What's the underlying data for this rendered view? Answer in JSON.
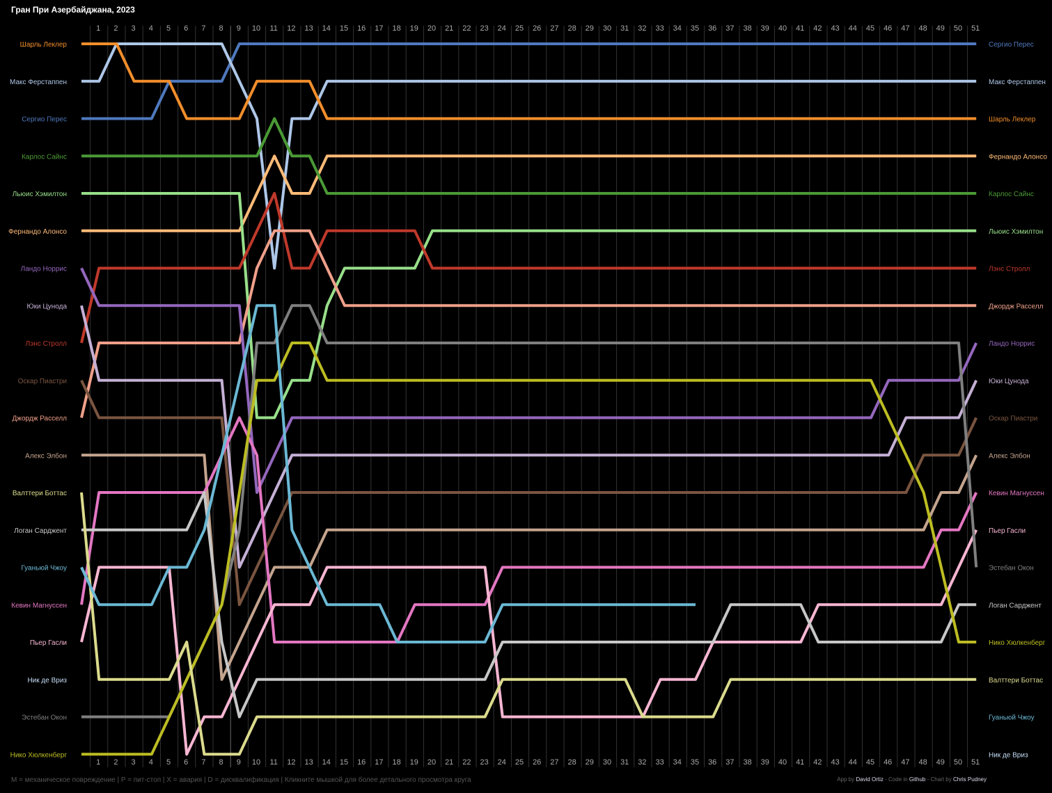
{
  "title": "Гран При Азербайджана, 2023",
  "footer": {
    "legend": "M = механическое повреждение | P = пит-стоп | X = авария | D = дисквалификация | Кликните мышкой для более детального просмотра круга",
    "credits": {
      "app_prefix": "App by ",
      "app_author": "David Ortiz",
      "code_prefix": " - Code in ",
      "code_host": "Github",
      "chart_prefix": " - Chart by ",
      "chart_author": "Chris Pudney"
    }
  },
  "chart_data": {
    "type": "line",
    "title": "Гран При Азербайджана, 2023",
    "x_labels": [
      "1",
      "2",
      "3",
      "4",
      "5",
      "6",
      "7",
      "8",
      "9",
      "10",
      "11",
      "12",
      "13",
      "14",
      "15",
      "16",
      "17",
      "18",
      "19",
      "20",
      "21",
      "22",
      "23",
      "24",
      "25",
      "26",
      "27",
      "28",
      "29",
      "30",
      "31",
      "32",
      "33",
      "34",
      "35",
      "36",
      "37",
      "38",
      "39",
      "40",
      "41",
      "42",
      "43",
      "44",
      "45",
      "46",
      "47",
      "48",
      "49",
      "50",
      "51"
    ],
    "xlim": [
      0,
      51
    ],
    "y_axis": "position",
    "ylim": [
      1,
      20
    ],
    "y_inverted": true,
    "grid": true,
    "series": [
      {
        "name": "Сергио Перес",
        "color": "#4f79bd",
        "start": 3,
        "laps": [
          3,
          3,
          3,
          3,
          2,
          2,
          2,
          2,
          1,
          1,
          1,
          1,
          1,
          1,
          1,
          1,
          1,
          1,
          1,
          1,
          1,
          1,
          1,
          1,
          1,
          1,
          1,
          1,
          1,
          1,
          1,
          1,
          1,
          1,
          1,
          1,
          1,
          1,
          1,
          1,
          1,
          1,
          1,
          1,
          1,
          1,
          1,
          1,
          1,
          1,
          1
        ]
      },
      {
        "name": "Макс Ферстаппен",
        "color": "#aec7e8",
        "start": 2,
        "laps": [
          2,
          1,
          1,
          1,
          1,
          1,
          1,
          1,
          2,
          3,
          7,
          3,
          3,
          2,
          2,
          2,
          2,
          2,
          2,
          2,
          2,
          2,
          2,
          2,
          2,
          2,
          2,
          2,
          2,
          2,
          2,
          2,
          2,
          2,
          2,
          2,
          2,
          2,
          2,
          2,
          2,
          2,
          2,
          2,
          2,
          2,
          2,
          2,
          2,
          2,
          2
        ]
      },
      {
        "name": "Шарль Леклер",
        "color": "#f28e2b",
        "start": 1,
        "laps": [
          1,
          1,
          2,
          2,
          2,
          3,
          3,
          3,
          3,
          2,
          2,
          2,
          2,
          3,
          3,
          3,
          3,
          3,
          3,
          3,
          3,
          3,
          3,
          3,
          3,
          3,
          3,
          3,
          3,
          3,
          3,
          3,
          3,
          3,
          3,
          3,
          3,
          3,
          3,
          3,
          3,
          3,
          3,
          3,
          3,
          3,
          3,
          3,
          3,
          3,
          3
        ]
      },
      {
        "name": "Фернандо Алонсо",
        "color": "#ffbb78",
        "start": 6,
        "laps": [
          6,
          6,
          6,
          6,
          6,
          6,
          6,
          6,
          6,
          5,
          4,
          5,
          5,
          4,
          4,
          4,
          4,
          4,
          4,
          4,
          4,
          4,
          4,
          4,
          4,
          4,
          4,
          4,
          4,
          4,
          4,
          4,
          4,
          4,
          4,
          4,
          4,
          4,
          4,
          4,
          4,
          4,
          4,
          4,
          4,
          4,
          4,
          4,
          4,
          4,
          4
        ]
      },
      {
        "name": "Карлос Сайнс",
        "color": "#4a9a35",
        "start": 4,
        "laps": [
          4,
          4,
          4,
          4,
          4,
          4,
          4,
          4,
          4,
          4,
          3,
          4,
          4,
          5,
          5,
          5,
          5,
          5,
          5,
          5,
          5,
          5,
          5,
          5,
          5,
          5,
          5,
          5,
          5,
          5,
          5,
          5,
          5,
          5,
          5,
          5,
          5,
          5,
          5,
          5,
          5,
          5,
          5,
          5,
          5,
          5,
          5,
          5,
          5,
          5,
          5
        ]
      },
      {
        "name": "Льюис Хэмилтон",
        "color": "#98df8a",
        "start": 5,
        "laps": [
          5,
          5,
          5,
          5,
          5,
          5,
          5,
          5,
          5,
          11,
          11,
          10,
          10,
          8,
          7,
          7,
          7,
          7,
          7,
          6,
          6,
          6,
          6,
          6,
          6,
          6,
          6,
          6,
          6,
          6,
          6,
          6,
          6,
          6,
          6,
          6,
          6,
          6,
          6,
          6,
          6,
          6,
          6,
          6,
          6,
          6,
          6,
          6,
          6,
          6,
          6
        ]
      },
      {
        "name": "Лэнс Стролл",
        "color": "#c0392b",
        "start": 9,
        "laps": [
          7,
          7,
          7,
          7,
          7,
          7,
          7,
          7,
          7,
          6,
          5,
          7,
          7,
          6,
          6,
          6,
          6,
          6,
          6,
          7,
          7,
          7,
          7,
          7,
          7,
          7,
          7,
          7,
          7,
          7,
          7,
          7,
          7,
          7,
          7,
          7,
          7,
          7,
          7,
          7,
          7,
          7,
          7,
          7,
          7,
          7,
          7,
          7,
          7,
          7,
          7
        ]
      },
      {
        "name": "Джордж Расселл",
        "color": "#f0a08a",
        "start": 11,
        "laps": [
          9,
          9,
          9,
          9,
          9,
          9,
          9,
          9,
          9,
          7,
          6,
          6,
          6,
          7,
          8,
          8,
          8,
          8,
          8,
          8,
          8,
          8,
          8,
          8,
          8,
          8,
          8,
          8,
          8,
          8,
          8,
          8,
          8,
          8,
          8,
          8,
          8,
          8,
          8,
          8,
          8,
          8,
          8,
          8,
          8,
          8,
          8,
          8,
          8,
          8,
          8
        ]
      },
      {
        "name": "Ландо Норрис",
        "color": "#9467bd",
        "start": 7,
        "laps": [
          8,
          8,
          8,
          8,
          8,
          8,
          8,
          8,
          8,
          13,
          12,
          11,
          11,
          11,
          11,
          11,
          11,
          11,
          11,
          11,
          11,
          11,
          11,
          11,
          11,
          11,
          11,
          11,
          11,
          11,
          11,
          11,
          11,
          11,
          11,
          11,
          11,
          11,
          11,
          11,
          11,
          11,
          11,
          11,
          11,
          10,
          10,
          10,
          10,
          10,
          9
        ]
      },
      {
        "name": "Юки Цунода",
        "color": "#c5b0d5",
        "start": 8,
        "laps": [
          10,
          10,
          10,
          10,
          10,
          10,
          10,
          10,
          15,
          14,
          13,
          12,
          12,
          12,
          12,
          12,
          12,
          12,
          12,
          12,
          12,
          12,
          12,
          12,
          12,
          12,
          12,
          12,
          12,
          12,
          12,
          12,
          12,
          12,
          12,
          12,
          12,
          12,
          12,
          12,
          12,
          12,
          12,
          12,
          12,
          12,
          11,
          11,
          11,
          11,
          10
        ]
      },
      {
        "name": "Оскар Пиастри",
        "color": "#7a5540",
        "start": 10,
        "laps": [
          11,
          11,
          11,
          11,
          11,
          11,
          11,
          11,
          16,
          15,
          14,
          13,
          13,
          13,
          13,
          13,
          13,
          13,
          13,
          13,
          13,
          13,
          13,
          13,
          13,
          13,
          13,
          13,
          13,
          13,
          13,
          13,
          13,
          13,
          13,
          13,
          13,
          13,
          13,
          13,
          13,
          13,
          13,
          13,
          13,
          13,
          13,
          12,
          12,
          12,
          11
        ]
      },
      {
        "name": "Алекс Элбон",
        "color": "#c4a48e",
        "start": 12,
        "laps": [
          12,
          12,
          12,
          12,
          12,
          12,
          12,
          18,
          17,
          16,
          15,
          15,
          15,
          14,
          14,
          14,
          14,
          14,
          14,
          14,
          14,
          14,
          14,
          14,
          14,
          14,
          14,
          14,
          14,
          14,
          14,
          14,
          14,
          14,
          14,
          14,
          14,
          14,
          14,
          14,
          14,
          14,
          14,
          14,
          14,
          14,
          14,
          14,
          13,
          13,
          12
        ]
      },
      {
        "name": "Кевин Магнуссен",
        "color": "#e377c2",
        "start": 16,
        "laps": [
          13,
          13,
          13,
          13,
          13,
          13,
          13,
          12,
          11,
          12,
          17,
          17,
          17,
          17,
          17,
          17,
          17,
          17,
          16,
          16,
          16,
          16,
          16,
          15,
          15,
          15,
          15,
          15,
          15,
          15,
          15,
          15,
          15,
          15,
          15,
          15,
          15,
          15,
          15,
          15,
          15,
          15,
          15,
          15,
          15,
          15,
          15,
          15,
          14,
          14,
          13
        ]
      },
      {
        "name": "Пьер Гасли",
        "color": "#f7b6d2",
        "start": 17,
        "laps": [
          15,
          15,
          15,
          15,
          15,
          20,
          19,
          19,
          18,
          17,
          16,
          16,
          16,
          15,
          15,
          15,
          15,
          15,
          15,
          15,
          15,
          15,
          15,
          19,
          19,
          19,
          19,
          19,
          19,
          19,
          19,
          19,
          18,
          18,
          18,
          17,
          17,
          17,
          17,
          17,
          17,
          16,
          16,
          16,
          16,
          16,
          16,
          16,
          16,
          15,
          14
        ]
      },
      {
        "name": "Эстебан Окон",
        "color": "#7f7f7f",
        "start": 19,
        "laps": [
          19,
          19,
          19,
          19,
          19,
          18,
          17,
          16,
          14,
          9,
          9,
          8,
          8,
          9,
          9,
          9,
          9,
          9,
          9,
          9,
          9,
          9,
          9,
          9,
          9,
          9,
          9,
          9,
          9,
          9,
          9,
          9,
          9,
          9,
          9,
          9,
          9,
          9,
          9,
          9,
          9,
          9,
          9,
          9,
          9,
          9,
          9,
          9,
          9,
          9,
          15
        ]
      },
      {
        "name": "Логан Сарджент",
        "color": "#c7c7c7",
        "start": 14,
        "laps": [
          14,
          14,
          14,
          14,
          14,
          14,
          13,
          17,
          19,
          18,
          18,
          18,
          18,
          18,
          18,
          18,
          18,
          18,
          18,
          18,
          18,
          18,
          18,
          17,
          17,
          17,
          17,
          17,
          17,
          17,
          17,
          17,
          17,
          17,
          17,
          17,
          16,
          16,
          16,
          16,
          16,
          17,
          17,
          17,
          17,
          17,
          17,
          17,
          17,
          16,
          16
        ]
      },
      {
        "name": "Нико Хюлкенберг",
        "color": "#bcbd22",
        "start": 20,
        "laps": [
          20,
          20,
          20,
          20,
          19,
          18,
          17,
          16,
          13,
          10,
          10,
          9,
          9,
          10,
          10,
          10,
          10,
          10,
          10,
          10,
          10,
          10,
          10,
          10,
          10,
          10,
          10,
          10,
          10,
          10,
          10,
          10,
          10,
          10,
          10,
          10,
          10,
          10,
          10,
          10,
          10,
          10,
          10,
          10,
          10,
          11,
          12,
          13,
          15,
          17,
          17
        ]
      },
      {
        "name": "Валттери Боттас",
        "color": "#dbdb8d",
        "start": 13,
        "laps": [
          18,
          18,
          18,
          18,
          18,
          17,
          20,
          20,
          20,
          19,
          19,
          19,
          19,
          19,
          19,
          19,
          19,
          19,
          19,
          19,
          19,
          19,
          19,
          18,
          18,
          18,
          18,
          18,
          18,
          18,
          18,
          19,
          19,
          19,
          19,
          19,
          18,
          18,
          18,
          18,
          18,
          18,
          18,
          18,
          18,
          18,
          18,
          18,
          18,
          18,
          18
        ]
      },
      {
        "name": "Гуаньюй Чжоу",
        "color": "#6bb8d4",
        "start": 15,
        "laps": [
          16,
          16,
          16,
          16,
          15,
          15,
          14,
          12,
          10,
          8,
          8,
          14,
          15,
          16,
          16,
          16,
          16,
          17,
          17,
          17,
          17,
          17,
          17,
          16,
          16,
          16,
          16,
          16,
          16,
          16,
          16,
          16,
          16,
          16,
          16
        ]
      },
      {
        "name": "Ник де Вриз",
        "color": "#c4dcf5",
        "start": 18,
        "laps": []
      }
    ],
    "left_labels": [
      "Шарль Леклер",
      "Макс Ферстаппен",
      "Сергио Перес",
      "Карлос Сайнс",
      "Льюис Хэмилтон",
      "Фернандо Алонсо",
      "Ландо Норрис",
      "Юки Цунода",
      "Лэнс Стролл",
      "Оскар Пиастри",
      "Джордж Расселл",
      "Алекс Элбон",
      "Валттери Боттас",
      "Логан Сарджент",
      "Гуаньюй Чжоу",
      "Кевин Магнуссен",
      "Пьер Гасли",
      "Ник де Вриз",
      "Эстебан Окон",
      "Нико Хюлкенберг"
    ],
    "right_labels": [
      "Сергио Перес",
      "Макс Ферстаппен",
      "Шарль Леклер",
      "Фернандо Алонсо",
      "Карлос Сайнс",
      "Льюис Хэмилтон",
      "Лэнс Стролл",
      "Джордж Расселл",
      "Ландо Норрис",
      "Юки Цунода",
      "Оскар Пиастри",
      "Алекс Элбон",
      "Кевин Магнуссен",
      "Пьер Гасли",
      "Эстебан Окон",
      "Логан Сарджент",
      "Нико Хюлкенберг",
      "Валттери Боттас",
      "Гуаньюй Чжоу",
      "Ник де Вриз"
    ]
  }
}
